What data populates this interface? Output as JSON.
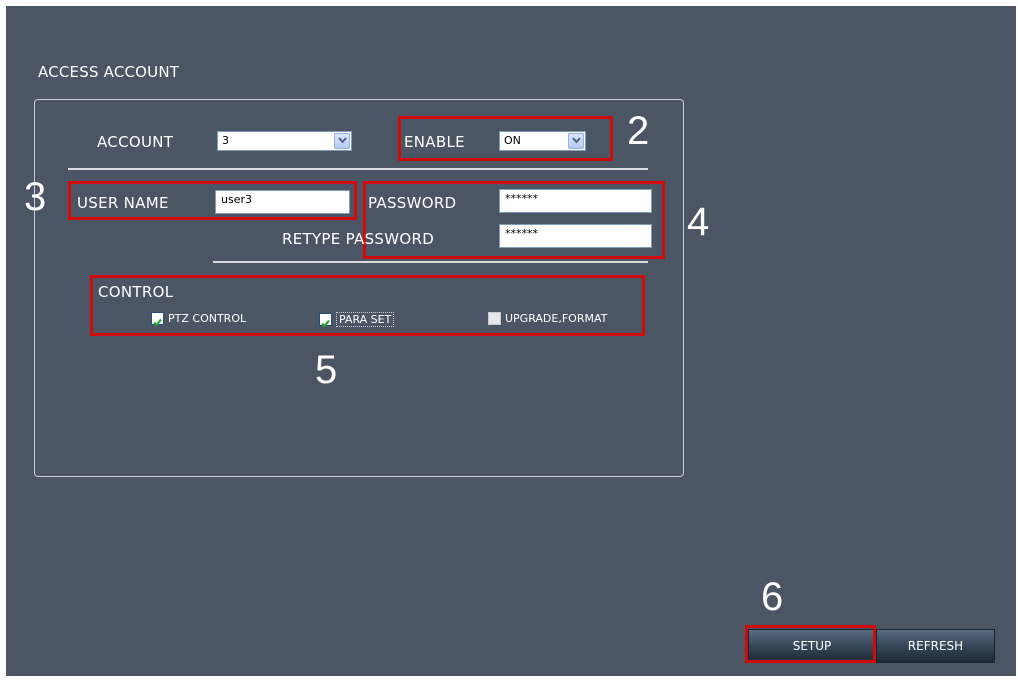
{
  "section": {
    "title": "ACCESS ACCOUNT"
  },
  "account": {
    "label": "ACCOUNT",
    "value": "3"
  },
  "enable": {
    "label": "ENABLE",
    "value": "ON"
  },
  "user": {
    "label": "USER NAME",
    "value": "user3"
  },
  "password": {
    "label": "PASSWORD",
    "value": "******"
  },
  "retype": {
    "label_prefix": "RETYPE",
    "label": "PASSWORD",
    "value": "******"
  },
  "control": {
    "label": "CONTROL",
    "items": [
      {
        "label": "PTZ CONTROL",
        "checked": true
      },
      {
        "label": "PARA SET",
        "checked": true
      },
      {
        "label": "UPGRADE,FORMAT",
        "checked": false
      }
    ]
  },
  "callouts": {
    "c2": "2",
    "c3": "3",
    "c4": "4",
    "c5": "5",
    "c6": "6"
  },
  "buttons": {
    "setup": "SETUP",
    "refresh": "REFRESH"
  },
  "colors": {
    "background": "#4b5563",
    "highlight": "#d10a0a",
    "check": "#2aa82a"
  }
}
